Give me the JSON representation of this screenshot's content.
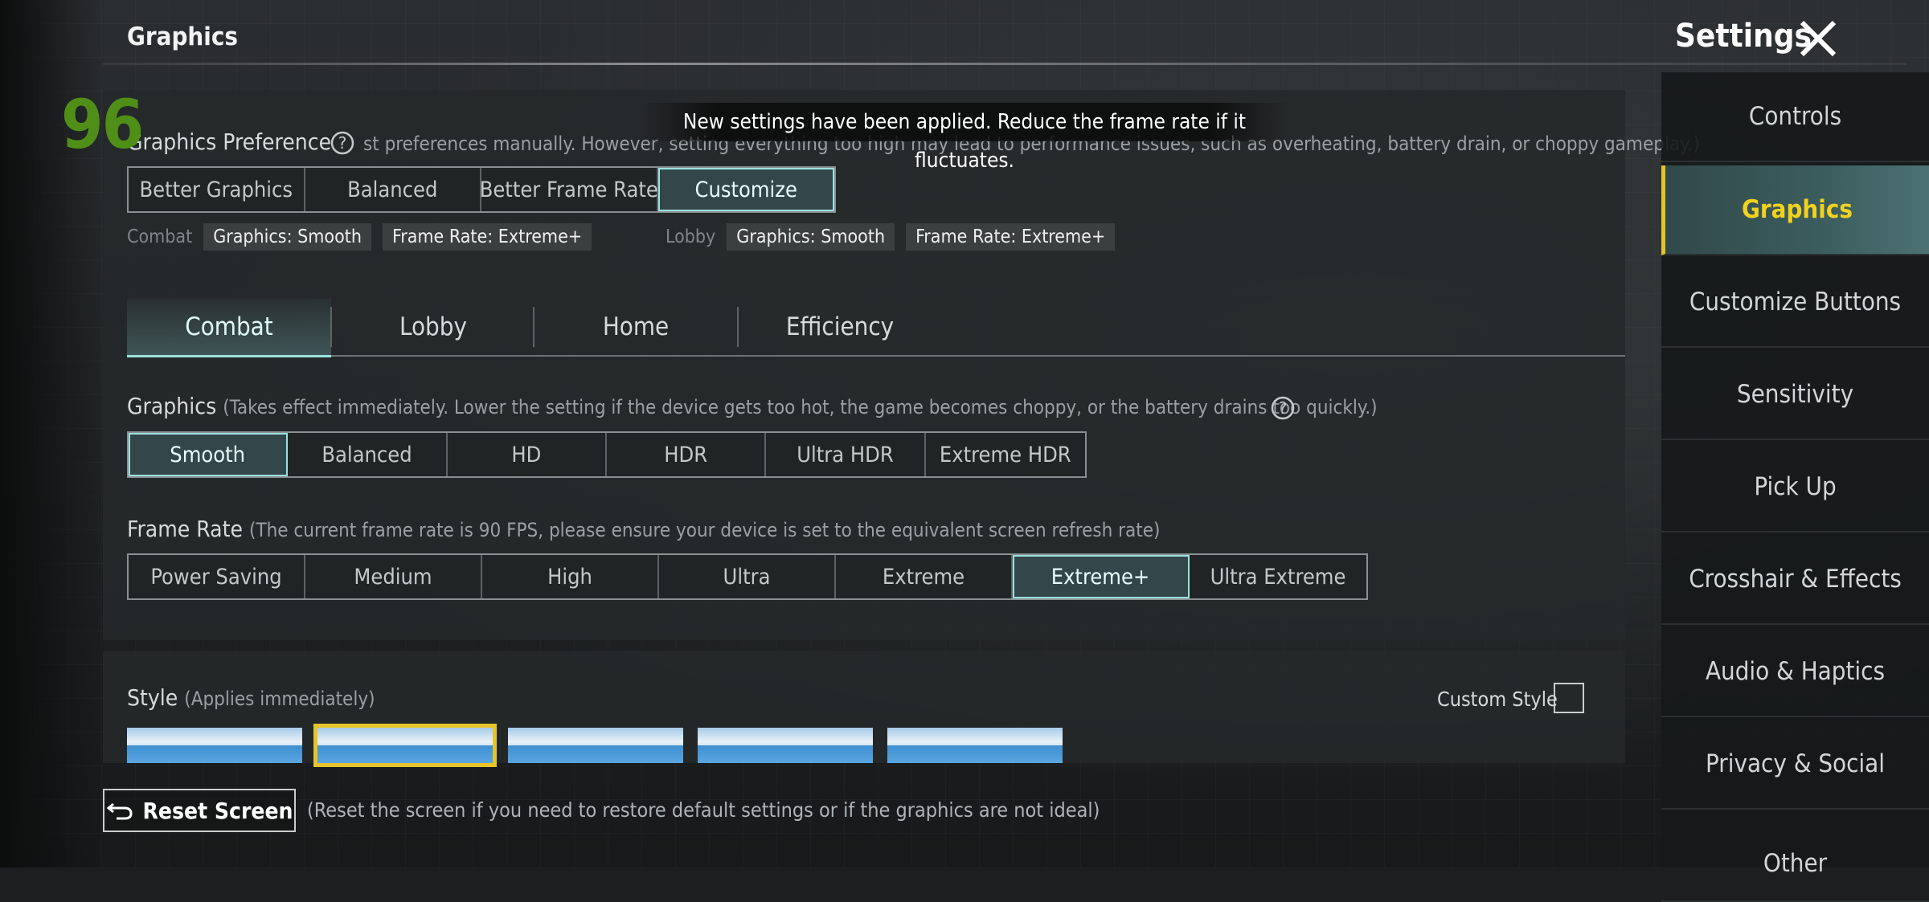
{
  "header": {
    "section_title": "Graphics",
    "settings_title": "Settings"
  },
  "fps": "96",
  "toast": "New settings have been applied. Reduce the frame rate if it fluctuates.",
  "preference": {
    "label": "Graphics Preference",
    "note": "st preferences manually. However, setting everything too high may lead to performance issues, such as overheating, battery drain, or choppy gameplay.)",
    "options": [
      "Better Graphics",
      "Balanced",
      "Better Frame Rate",
      "Customize"
    ],
    "selected": "Customize"
  },
  "summary": {
    "combat_label": "Combat",
    "combat_graphics": "Graphics: Smooth",
    "combat_framerate": "Frame Rate: Extreme+",
    "lobby_label": "Lobby",
    "lobby_graphics": "Graphics: Smooth",
    "lobby_framerate": "Frame Rate: Extreme+"
  },
  "tabs": [
    "Combat",
    "Lobby",
    "Home",
    "Efficiency"
  ],
  "active_tab": "Combat",
  "graphics": {
    "label": "Graphics",
    "note": "(Takes effect immediately. Lower the setting if the device gets too hot, the game becomes choppy, or the battery drains too quickly.)",
    "options": [
      "Smooth",
      "Balanced",
      "HD",
      "HDR",
      "Ultra HDR",
      "Extreme HDR"
    ],
    "selected": "Smooth"
  },
  "frame_rate": {
    "label": "Frame Rate",
    "note": "(The current frame rate is 90 FPS, please ensure your device is set to the equivalent screen refresh rate)",
    "options": [
      "Power Saving",
      "Medium",
      "High",
      "Ultra",
      "Extreme",
      "Extreme+",
      "Ultra Extreme"
    ],
    "selected": "Extreme+"
  },
  "style": {
    "label": "Style",
    "note": "(Applies immediately)",
    "custom_label": "Custom Style",
    "custom_checked": false,
    "selected_index": 1
  },
  "reset": {
    "label": "Reset Screen",
    "note": "(Reset the screen if you need to restore default settings or if the graphics are not ideal)"
  },
  "sidebar": {
    "items": [
      "Controls",
      "Graphics",
      "Customize Buttons",
      "Sensitivity",
      "Pick Up",
      "Crosshair & Effects",
      "Audio & Haptics",
      "Privacy & Social",
      "Other"
    ],
    "active": "Graphics"
  },
  "colors": {
    "accent": "#9be3df",
    "highlight": "#e6c42a",
    "fps": "#4f8f18"
  }
}
